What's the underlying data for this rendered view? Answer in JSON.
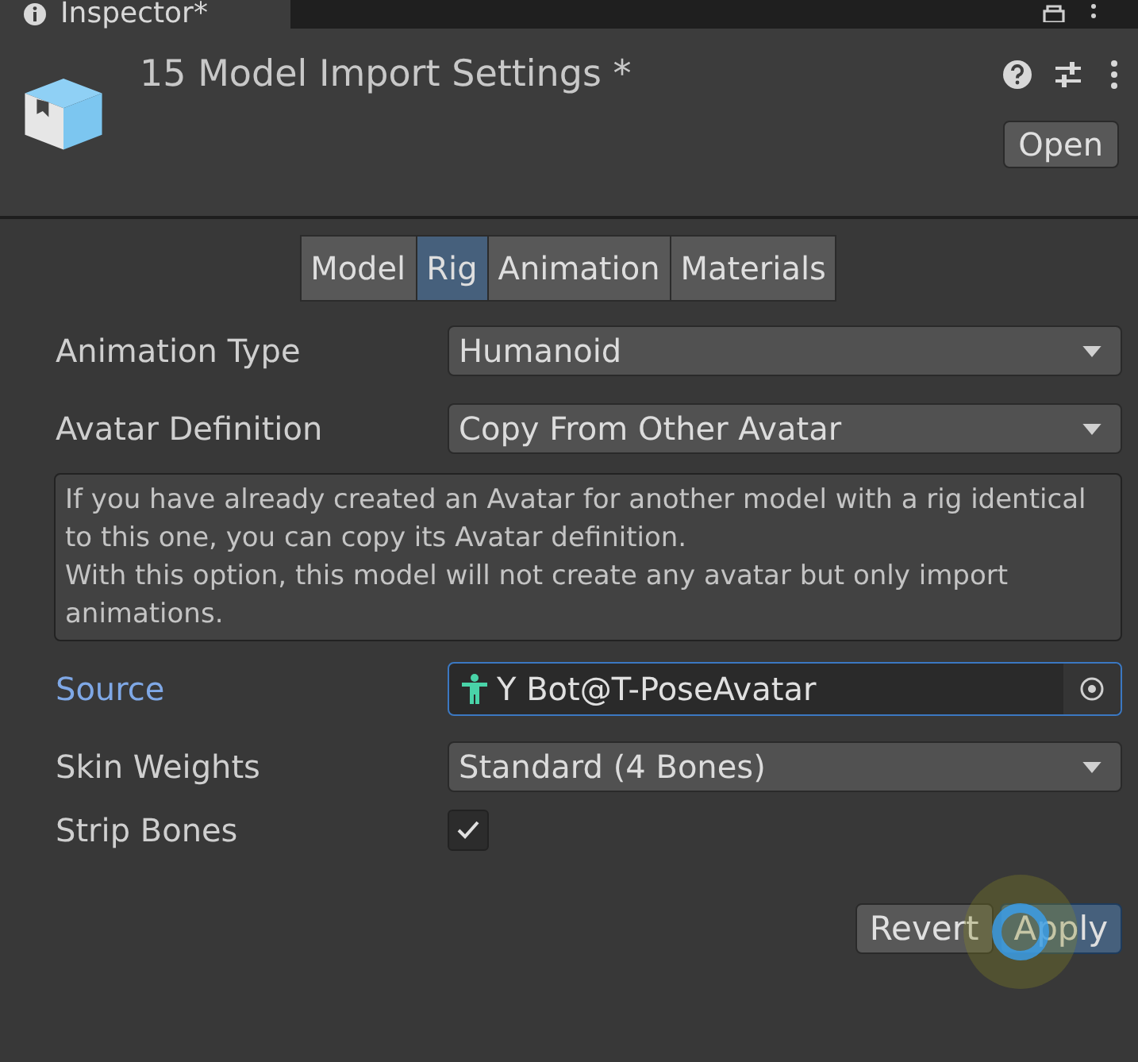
{
  "window": {
    "title": "Inspector*"
  },
  "header": {
    "title": "15 Model Import Settings *",
    "open_button": "Open"
  },
  "tabs": [
    {
      "label": "Model",
      "selected": false
    },
    {
      "label": "Rig",
      "selected": true
    },
    {
      "label": "Animation",
      "selected": false
    },
    {
      "label": "Materials",
      "selected": false
    }
  ],
  "fields": [
    {
      "kind": "dropdown",
      "label": "Animation Type",
      "value": "Humanoid"
    },
    {
      "kind": "dropdown",
      "label": "Avatar Definition",
      "value": "Copy From Other Avatar"
    },
    {
      "kind": "help",
      "text": "If you have already created an Avatar for another model with a rig identical to this one, you can copy its Avatar definition.\nWith this option, this model will not create any avatar but only import animations."
    },
    {
      "kind": "object",
      "label": "Source",
      "value": "Y Bot@T-PoseAvatar",
      "focused": true
    },
    {
      "kind": "dropdown",
      "label": "Skin Weights",
      "value": "Standard (4 Bones)"
    },
    {
      "kind": "checkbox",
      "label": "Strip Bones",
      "checked": true
    }
  ],
  "buttons": [
    {
      "label": "Revert",
      "kind": "normal"
    },
    {
      "label": "Apply",
      "kind": "primary"
    }
  ]
}
